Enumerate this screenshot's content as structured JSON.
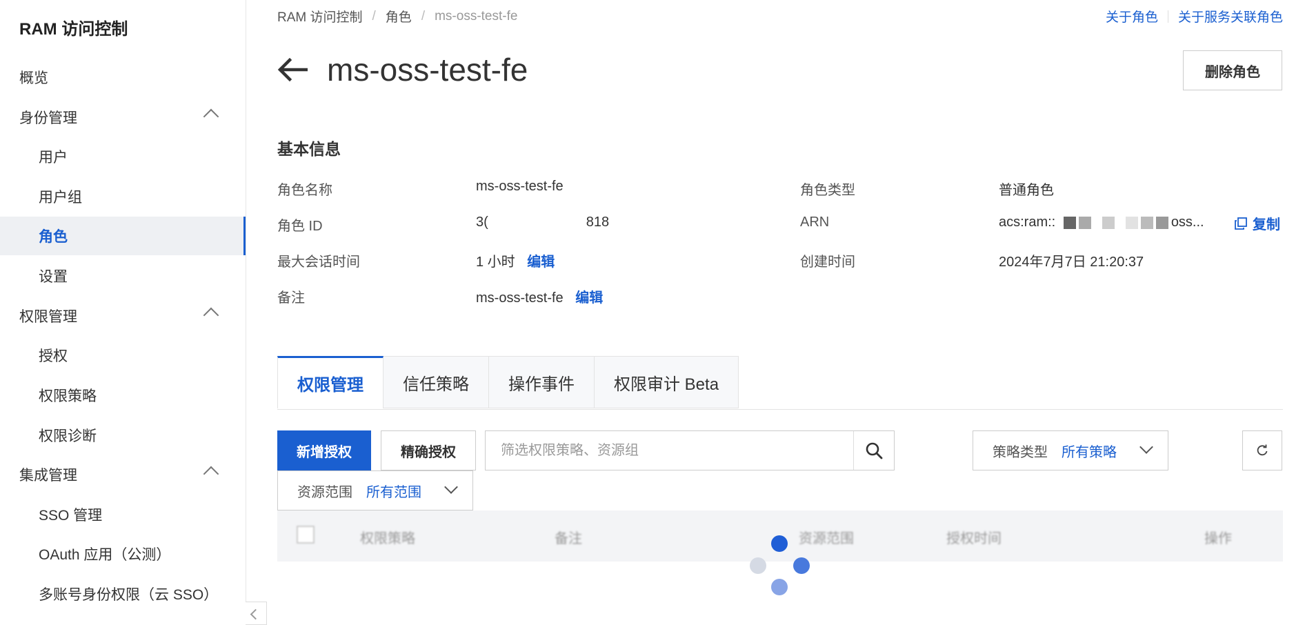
{
  "app": {
    "title": "RAM 访问控制"
  },
  "sidebar": {
    "items": [
      {
        "label": "概览"
      },
      {
        "label": "身份管理"
      },
      {
        "label": "用户"
      },
      {
        "label": "用户组"
      },
      {
        "label": "角色"
      },
      {
        "label": "设置"
      },
      {
        "label": "权限管理"
      },
      {
        "label": "授权"
      },
      {
        "label": "权限策略"
      },
      {
        "label": "权限诊断"
      },
      {
        "label": "集成管理"
      },
      {
        "label": "SSO 管理"
      },
      {
        "label": "OAuth 应用（公测）"
      },
      {
        "label": "多账号身份权限（云 SSO）"
      }
    ]
  },
  "breadcrumb": [
    "RAM 访问控制",
    "角色",
    "ms-oss-test-fe"
  ],
  "top_links": {
    "about_role": "关于角色",
    "about_service_role": "关于服务关联角色"
  },
  "header": {
    "title": "ms-oss-test-fe",
    "delete_label": "删除角色"
  },
  "basic_info": {
    "title": "基本信息",
    "role_name_label": "角色名称",
    "role_name": "ms-oss-test-fe",
    "role_id_label": "角色 ID",
    "role_id_prefix": "3(",
    "role_id_suffix": "818",
    "max_session_label": "最大会话时间",
    "max_session": "1 小时",
    "remark_label": "备注",
    "remark": "ms-oss-test-fe",
    "edit_label": "编辑",
    "role_type_label": "角色类型",
    "role_type": "普通角色",
    "arn_label": "ARN",
    "arn_prefix": "acs:ram::",
    "arn_suffix": "oss...",
    "copy_label": "复制",
    "created_label": "创建时间",
    "created": "2024年7月7日 21:20:37"
  },
  "tabs": [
    {
      "label": "权限管理"
    },
    {
      "label": "信任策略"
    },
    {
      "label": "操作事件"
    },
    {
      "label": "权限审计 Beta"
    }
  ],
  "toolbar": {
    "add_label": "新增授权",
    "precise_label": "精确授权",
    "search_placeholder": "筛选权限策略、资源组",
    "policy_type_label": "策略类型",
    "policy_type_value": "所有策略",
    "scope_label": "资源范围",
    "scope_value": "所有范围"
  },
  "table": {
    "columns": [
      "权限策略",
      "备注",
      "资源范围",
      "授权时间",
      "操作"
    ]
  },
  "colors": {
    "accent": "#1a5fd0",
    "active_bg": "#eef0f3"
  }
}
